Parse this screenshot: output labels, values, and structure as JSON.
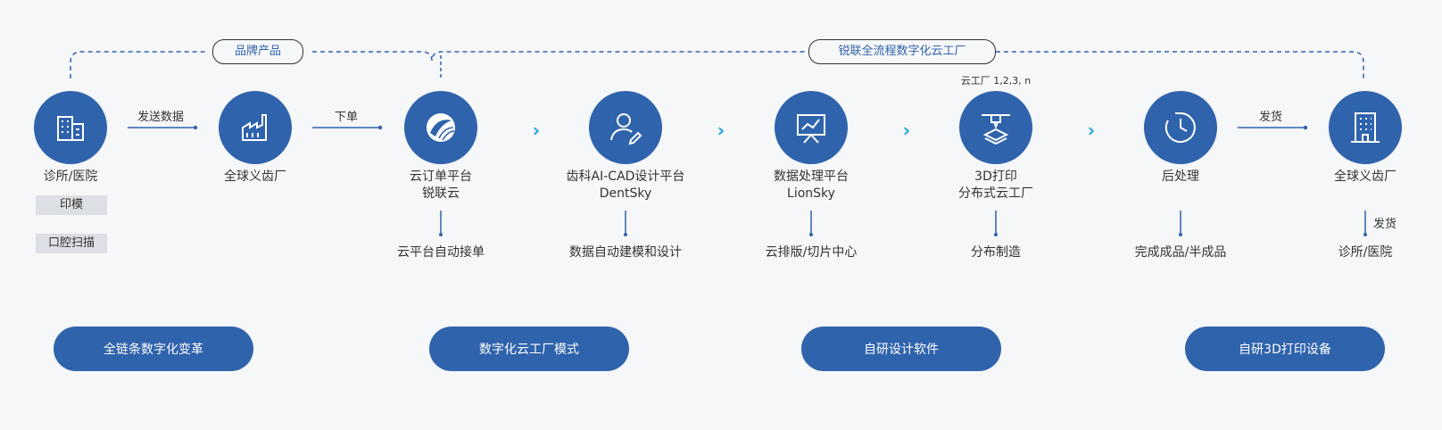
{
  "brackets": {
    "left_label": "品牌产品",
    "right_label": "锐联全流程数字化云工厂"
  },
  "nodes": [
    {
      "name": "诊所/医院",
      "icon": "building-icon"
    },
    {
      "name": "全球义齿厂",
      "icon": "factory-icon"
    },
    {
      "name": "云订单平台",
      "name2": "锐联云",
      "icon": "logo-icon"
    },
    {
      "name": "齿科AI-CAD设计平台",
      "name2": "DentSky",
      "icon": "user-pen-icon"
    },
    {
      "name": "数据处理平台",
      "name2": "LionSky",
      "icon": "chart-board-icon"
    },
    {
      "name": "3D打印",
      "name2": "分布式云工厂",
      "icon": "3d-printer-icon"
    },
    {
      "name": "后处理",
      "icon": "clock-icon"
    },
    {
      "name": "全球义齿厂",
      "icon": "office-icon"
    }
  ],
  "arrows": {
    "send_data": "发送数据",
    "order": "下单",
    "ship_top": "发货",
    "ship_down": "发货"
  },
  "tags": [
    "印模",
    "口腔扫描"
  ],
  "above_printer": "云工厂 1,2,3, n",
  "below_labels": [
    "云平台自动接单",
    "数据自动建模和设计",
    "云排版/切片中心",
    "分布制造",
    "完成成品/半成品",
    "诊所/医院"
  ],
  "pills": [
    "全链条数字化变革",
    "数字化云工厂模式",
    "自研设计软件",
    "自研3D打印设备"
  ],
  "colors": {
    "primary": "#2f63ac",
    "chevron": "#2aa8e0",
    "background": "#f6f7f8"
  }
}
